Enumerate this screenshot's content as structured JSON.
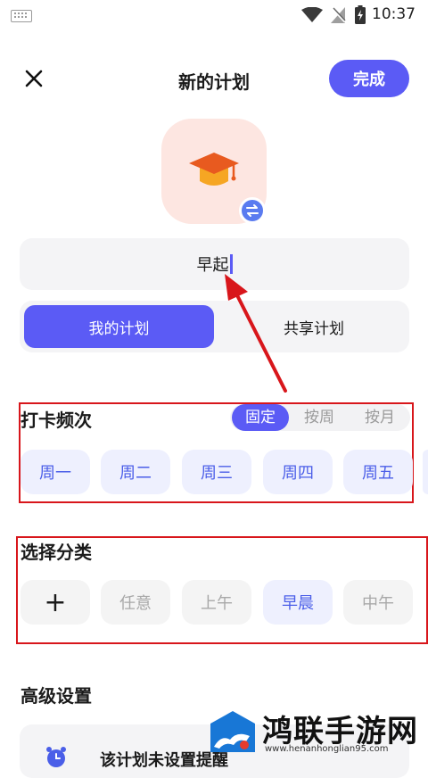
{
  "status_bar": {
    "time": "10:37"
  },
  "header": {
    "title": "新的计划",
    "done_label": "完成"
  },
  "plan_icon": {
    "icon": "graduation-cap-icon",
    "swap_icon": "swap-icon"
  },
  "name_field": {
    "value": "早起"
  },
  "plan_type": {
    "mine_label": "我的计划",
    "shared_label": "共享计划"
  },
  "frequency": {
    "title": "打卡频次",
    "modes": [
      "固定",
      "按周",
      "按月"
    ],
    "selected_mode": "固定",
    "days": [
      "周一",
      "周二",
      "周三",
      "周四",
      "周五"
    ]
  },
  "category": {
    "title": "选择分类",
    "add_symbol": "+",
    "items": [
      "任意",
      "上午",
      "早晨",
      "中午"
    ],
    "selected": "早晨"
  },
  "advanced": {
    "title": "高级设置",
    "item_label": "该计划未设置提醒"
  },
  "watermark": {
    "brand": "鸿联手游网",
    "url": "www.henanhonglian95.com"
  },
  "colors": {
    "accent": "#5b5bf5",
    "accent_light": "#eef0fe",
    "annotation_red": "#d8161b",
    "icon_bg": "#fde6e1"
  }
}
